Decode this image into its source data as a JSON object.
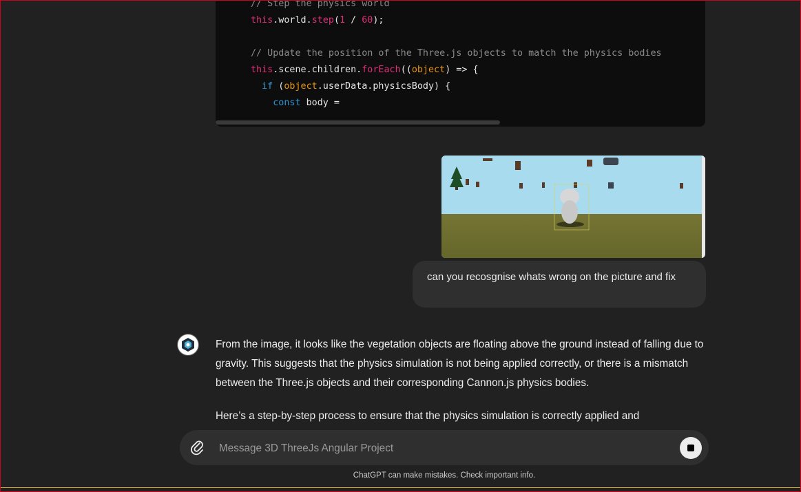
{
  "code": {
    "lines": [
      [
        {
          "t": "// Step the physics world",
          "c": "c-com"
        }
      ],
      [
        {
          "t": "this",
          "c": "c-this"
        },
        {
          "t": ".world.",
          "c": "c-plain"
        },
        {
          "t": "step",
          "c": "c-fn"
        },
        {
          "t": "(",
          "c": "c-plain"
        },
        {
          "t": "1",
          "c": "c-num"
        },
        {
          "t": " / ",
          "c": "c-plain"
        },
        {
          "t": "60",
          "c": "c-num"
        },
        {
          "t": ");",
          "c": "c-plain"
        }
      ],
      [],
      [
        {
          "t": "// Update the position of the Three.js objects to match the physics bodies",
          "c": "c-com"
        }
      ],
      [
        {
          "t": "this",
          "c": "c-this"
        },
        {
          "t": ".scene.children.",
          "c": "c-plain"
        },
        {
          "t": "forEach",
          "c": "c-fn"
        },
        {
          "t": "((",
          "c": "c-plain"
        },
        {
          "t": "object",
          "c": "c-var"
        },
        {
          "t": ") => {",
          "c": "c-plain"
        }
      ],
      [
        {
          "t": "  ",
          "c": "c-plain"
        },
        {
          "t": "if",
          "c": "c-kw"
        },
        {
          "t": " (",
          "c": "c-plain"
        },
        {
          "t": "object",
          "c": "c-var"
        },
        {
          "t": ".userData.physicsBody) {",
          "c": "c-plain"
        }
      ],
      [
        {
          "t": "    ",
          "c": "c-plain"
        },
        {
          "t": "const",
          "c": "c-kw"
        },
        {
          "t": " body =",
          "c": "c-plain"
        }
      ]
    ]
  },
  "user_message": {
    "text": "can you recosgnise whats wrong on the picture and fix"
  },
  "assistant_message": {
    "paragraphs": [
      "From the image, it looks like the vegetation objects are floating above the ground instead of falling due to gravity. This suggests that the physics simulation is not being applied correctly, or there is a mismatch between the Three.js objects and their corresponding Cannon.js physics bodies.",
      "Here’s a step-by-step process to ensure that the physics simulation is correctly applied and"
    ]
  },
  "composer": {
    "placeholder": "Message 3D ThreeJs Angular Project",
    "attach_icon": "paperclip-icon",
    "stop_icon": "stop-icon"
  },
  "footer": {
    "disclaimer": "ChatGPT can make mistakes. Check important info."
  },
  "colors": {
    "background": "#212121",
    "code_background": "#0d0d0d",
    "bubble": "#2f2f2f",
    "keyword_blue": "#2e95d3",
    "accent_pink": "#df3079",
    "param_orange": "#e9950c"
  }
}
